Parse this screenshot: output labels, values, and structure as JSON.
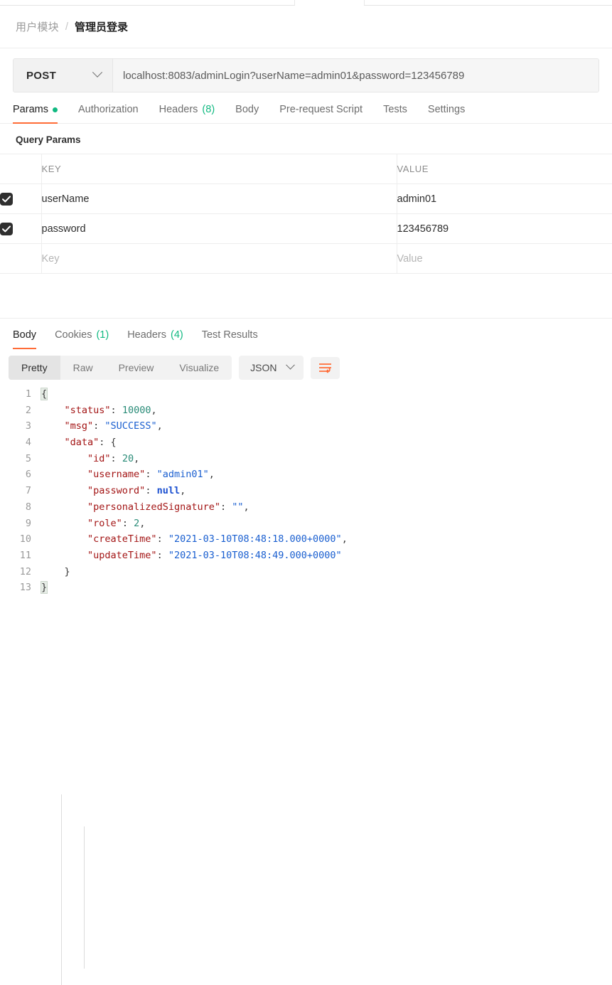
{
  "breadcrumb": {
    "parent": "用户模块",
    "separator": "/",
    "current": "管理员登录"
  },
  "request": {
    "method": "POST",
    "url": "localhost:8083/adminLogin?userName=admin01&password=123456789",
    "tabs": [
      {
        "label": "Params",
        "badge": "",
        "dot": true,
        "active": true
      },
      {
        "label": "Authorization",
        "badge": "",
        "dot": false,
        "active": false
      },
      {
        "label": "Headers",
        "badge": "(8)",
        "dot": false,
        "active": false
      },
      {
        "label": "Body",
        "badge": "",
        "dot": false,
        "active": false
      },
      {
        "label": "Pre-request Script",
        "badge": "",
        "dot": false,
        "active": false
      },
      {
        "label": "Tests",
        "badge": "",
        "dot": false,
        "active": false
      },
      {
        "label": "Settings",
        "badge": "",
        "dot": false,
        "active": false
      }
    ]
  },
  "params": {
    "section_title": "Query Params",
    "headers": {
      "key": "KEY",
      "value": "VALUE"
    },
    "rows": [
      {
        "checked": true,
        "key": "userName",
        "value": "admin01",
        "placeholder": false
      },
      {
        "checked": true,
        "key": "password",
        "value": "123456789",
        "placeholder": false
      },
      {
        "checked": false,
        "key": "Key",
        "value": "Value",
        "placeholder": true
      }
    ]
  },
  "response": {
    "tabs": [
      {
        "label": "Body",
        "badge": "",
        "active": true
      },
      {
        "label": "Cookies",
        "badge": "(1)",
        "active": false
      },
      {
        "label": "Headers",
        "badge": "(4)",
        "active": false
      },
      {
        "label": "Test Results",
        "badge": "",
        "active": false
      }
    ],
    "view_modes": [
      {
        "label": "Pretty",
        "active": true
      },
      {
        "label": "Raw",
        "active": false
      },
      {
        "label": "Preview",
        "active": false
      },
      {
        "label": "Visualize",
        "active": false
      }
    ],
    "format": "JSON",
    "wrap_icon": "word-wrap-icon",
    "body_lines": [
      {
        "no": "1",
        "indent": 0,
        "tokens": [
          {
            "t": "brace",
            "v": "{"
          }
        ]
      },
      {
        "no": "2",
        "indent": 1,
        "tokens": [
          {
            "t": "k",
            "v": "\"status\""
          },
          {
            "t": "p",
            "v": ": "
          },
          {
            "t": "n",
            "v": "10000"
          },
          {
            "t": "p",
            "v": ","
          }
        ]
      },
      {
        "no": "3",
        "indent": 1,
        "tokens": [
          {
            "t": "k",
            "v": "\"msg\""
          },
          {
            "t": "p",
            "v": ": "
          },
          {
            "t": "s",
            "v": "\"SUCCESS\""
          },
          {
            "t": "p",
            "v": ","
          }
        ]
      },
      {
        "no": "4",
        "indent": 1,
        "tokens": [
          {
            "t": "k",
            "v": "\"data\""
          },
          {
            "t": "p",
            "v": ": {"
          }
        ]
      },
      {
        "no": "5",
        "indent": 2,
        "tokens": [
          {
            "t": "k",
            "v": "\"id\""
          },
          {
            "t": "p",
            "v": ": "
          },
          {
            "t": "n",
            "v": "20"
          },
          {
            "t": "p",
            "v": ","
          }
        ]
      },
      {
        "no": "6",
        "indent": 2,
        "tokens": [
          {
            "t": "k",
            "v": "\"username\""
          },
          {
            "t": "p",
            "v": ": "
          },
          {
            "t": "s",
            "v": "\"admin01\""
          },
          {
            "t": "p",
            "v": ","
          }
        ]
      },
      {
        "no": "7",
        "indent": 2,
        "tokens": [
          {
            "t": "k",
            "v": "\"password\""
          },
          {
            "t": "p",
            "v": ": "
          },
          {
            "t": "nl",
            "v": "null"
          },
          {
            "t": "p",
            "v": ","
          }
        ]
      },
      {
        "no": "8",
        "indent": 2,
        "tokens": [
          {
            "t": "k",
            "v": "\"personalizedSignature\""
          },
          {
            "t": "p",
            "v": ": "
          },
          {
            "t": "s",
            "v": "\"\""
          },
          {
            "t": "p",
            "v": ","
          }
        ]
      },
      {
        "no": "9",
        "indent": 2,
        "tokens": [
          {
            "t": "k",
            "v": "\"role\""
          },
          {
            "t": "p",
            "v": ": "
          },
          {
            "t": "n",
            "v": "2"
          },
          {
            "t": "p",
            "v": ","
          }
        ]
      },
      {
        "no": "10",
        "indent": 2,
        "tokens": [
          {
            "t": "k",
            "v": "\"createTime\""
          },
          {
            "t": "p",
            "v": ": "
          },
          {
            "t": "s",
            "v": "\"2021-03-10T08:48:18.000+0000\""
          },
          {
            "t": "p",
            "v": ","
          }
        ]
      },
      {
        "no": "11",
        "indent": 2,
        "tokens": [
          {
            "t": "k",
            "v": "\"updateTime\""
          },
          {
            "t": "p",
            "v": ": "
          },
          {
            "t": "s",
            "v": "\"2021-03-10T08:48:49.000+0000\""
          }
        ]
      },
      {
        "no": "12",
        "indent": 1,
        "tokens": [
          {
            "t": "p",
            "v": "}"
          }
        ]
      },
      {
        "no": "13",
        "indent": 0,
        "tokens": [
          {
            "t": "brace",
            "v": "}"
          }
        ]
      }
    ]
  },
  "colors": {
    "accent": "#ff6c37",
    "green": "#10b981",
    "json_key": "#a31515",
    "json_string": "#1a5fd0",
    "json_number": "#2a8c78",
    "json_null": "#1a4fd0"
  }
}
